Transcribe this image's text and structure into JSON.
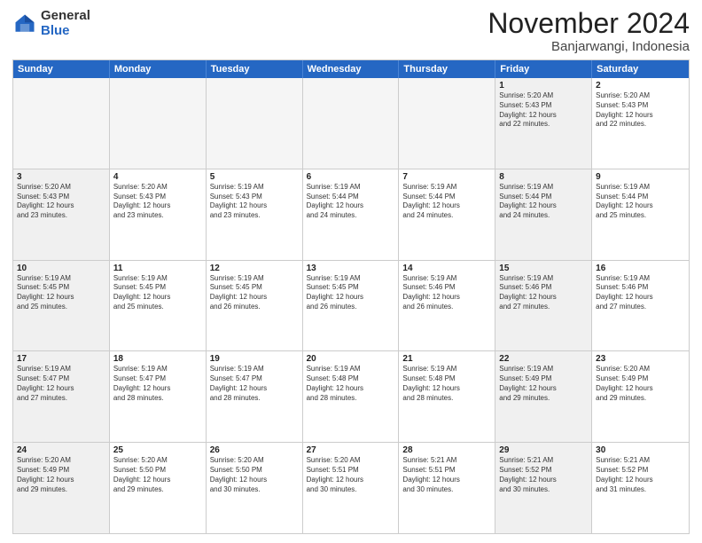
{
  "logo": {
    "general": "General",
    "blue": "Blue"
  },
  "title": "November 2024",
  "location": "Banjarwangi, Indonesia",
  "header_days": [
    "Sunday",
    "Monday",
    "Tuesday",
    "Wednesday",
    "Thursday",
    "Friday",
    "Saturday"
  ],
  "rows": [
    [
      {
        "day": "",
        "info": "",
        "empty": true
      },
      {
        "day": "",
        "info": "",
        "empty": true
      },
      {
        "day": "",
        "info": "",
        "empty": true
      },
      {
        "day": "",
        "info": "",
        "empty": true
      },
      {
        "day": "",
        "info": "",
        "empty": true
      },
      {
        "day": "1",
        "info": "Sunrise: 5:20 AM\nSunset: 5:43 PM\nDaylight: 12 hours\nand 22 minutes.",
        "shaded": true
      },
      {
        "day": "2",
        "info": "Sunrise: 5:20 AM\nSunset: 5:43 PM\nDaylight: 12 hours\nand 22 minutes.",
        "shaded": false
      }
    ],
    [
      {
        "day": "3",
        "info": "Sunrise: 5:20 AM\nSunset: 5:43 PM\nDaylight: 12 hours\nand 23 minutes.",
        "shaded": true
      },
      {
        "day": "4",
        "info": "Sunrise: 5:20 AM\nSunset: 5:43 PM\nDaylight: 12 hours\nand 23 minutes.",
        "shaded": false
      },
      {
        "day": "5",
        "info": "Sunrise: 5:19 AM\nSunset: 5:43 PM\nDaylight: 12 hours\nand 23 minutes.",
        "shaded": false
      },
      {
        "day": "6",
        "info": "Sunrise: 5:19 AM\nSunset: 5:44 PM\nDaylight: 12 hours\nand 24 minutes.",
        "shaded": false
      },
      {
        "day": "7",
        "info": "Sunrise: 5:19 AM\nSunset: 5:44 PM\nDaylight: 12 hours\nand 24 minutes.",
        "shaded": false
      },
      {
        "day": "8",
        "info": "Sunrise: 5:19 AM\nSunset: 5:44 PM\nDaylight: 12 hours\nand 24 minutes.",
        "shaded": true
      },
      {
        "day": "9",
        "info": "Sunrise: 5:19 AM\nSunset: 5:44 PM\nDaylight: 12 hours\nand 25 minutes.",
        "shaded": false
      }
    ],
    [
      {
        "day": "10",
        "info": "Sunrise: 5:19 AM\nSunset: 5:45 PM\nDaylight: 12 hours\nand 25 minutes.",
        "shaded": true
      },
      {
        "day": "11",
        "info": "Sunrise: 5:19 AM\nSunset: 5:45 PM\nDaylight: 12 hours\nand 25 minutes.",
        "shaded": false
      },
      {
        "day": "12",
        "info": "Sunrise: 5:19 AM\nSunset: 5:45 PM\nDaylight: 12 hours\nand 26 minutes.",
        "shaded": false
      },
      {
        "day": "13",
        "info": "Sunrise: 5:19 AM\nSunset: 5:45 PM\nDaylight: 12 hours\nand 26 minutes.",
        "shaded": false
      },
      {
        "day": "14",
        "info": "Sunrise: 5:19 AM\nSunset: 5:46 PM\nDaylight: 12 hours\nand 26 minutes.",
        "shaded": false
      },
      {
        "day": "15",
        "info": "Sunrise: 5:19 AM\nSunset: 5:46 PM\nDaylight: 12 hours\nand 27 minutes.",
        "shaded": true
      },
      {
        "day": "16",
        "info": "Sunrise: 5:19 AM\nSunset: 5:46 PM\nDaylight: 12 hours\nand 27 minutes.",
        "shaded": false
      }
    ],
    [
      {
        "day": "17",
        "info": "Sunrise: 5:19 AM\nSunset: 5:47 PM\nDaylight: 12 hours\nand 27 minutes.",
        "shaded": true
      },
      {
        "day": "18",
        "info": "Sunrise: 5:19 AM\nSunset: 5:47 PM\nDaylight: 12 hours\nand 28 minutes.",
        "shaded": false
      },
      {
        "day": "19",
        "info": "Sunrise: 5:19 AM\nSunset: 5:47 PM\nDaylight: 12 hours\nand 28 minutes.",
        "shaded": false
      },
      {
        "day": "20",
        "info": "Sunrise: 5:19 AM\nSunset: 5:48 PM\nDaylight: 12 hours\nand 28 minutes.",
        "shaded": false
      },
      {
        "day": "21",
        "info": "Sunrise: 5:19 AM\nSunset: 5:48 PM\nDaylight: 12 hours\nand 28 minutes.",
        "shaded": false
      },
      {
        "day": "22",
        "info": "Sunrise: 5:19 AM\nSunset: 5:49 PM\nDaylight: 12 hours\nand 29 minutes.",
        "shaded": true
      },
      {
        "day": "23",
        "info": "Sunrise: 5:20 AM\nSunset: 5:49 PM\nDaylight: 12 hours\nand 29 minutes.",
        "shaded": false
      }
    ],
    [
      {
        "day": "24",
        "info": "Sunrise: 5:20 AM\nSunset: 5:49 PM\nDaylight: 12 hours\nand 29 minutes.",
        "shaded": true
      },
      {
        "day": "25",
        "info": "Sunrise: 5:20 AM\nSunset: 5:50 PM\nDaylight: 12 hours\nand 29 minutes.",
        "shaded": false
      },
      {
        "day": "26",
        "info": "Sunrise: 5:20 AM\nSunset: 5:50 PM\nDaylight: 12 hours\nand 30 minutes.",
        "shaded": false
      },
      {
        "day": "27",
        "info": "Sunrise: 5:20 AM\nSunset: 5:51 PM\nDaylight: 12 hours\nand 30 minutes.",
        "shaded": false
      },
      {
        "day": "28",
        "info": "Sunrise: 5:21 AM\nSunset: 5:51 PM\nDaylight: 12 hours\nand 30 minutes.",
        "shaded": false
      },
      {
        "day": "29",
        "info": "Sunrise: 5:21 AM\nSunset: 5:52 PM\nDaylight: 12 hours\nand 30 minutes.",
        "shaded": true
      },
      {
        "day": "30",
        "info": "Sunrise: 5:21 AM\nSunset: 5:52 PM\nDaylight: 12 hours\nand 31 minutes.",
        "shaded": false
      }
    ]
  ]
}
